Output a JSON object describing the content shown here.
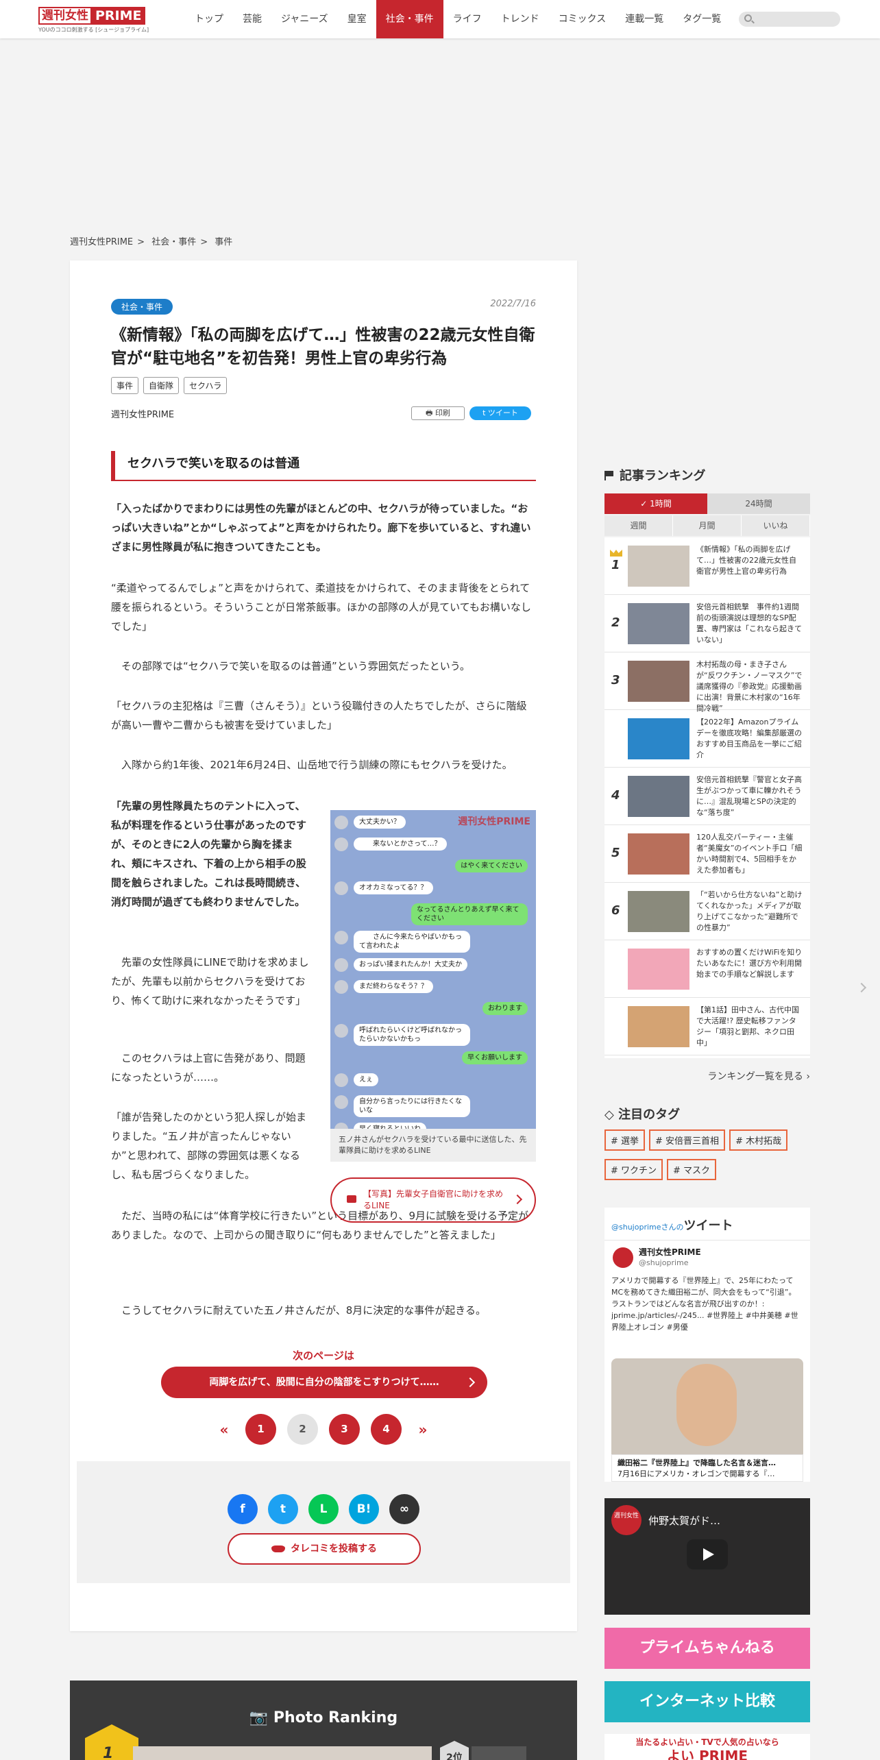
{
  "header": {
    "logo_main": "週刊女性",
    "logo_brand": "PRIME",
    "logo_sub": "YOUのココロ刺激する [シュージョプライム]",
    "nav": [
      "トップ",
      "芸能",
      "ジャニーズ",
      "皇室",
      "社会・事件",
      "ライフ",
      "トレンド",
      "コミックス",
      "連載一覧",
      "タグ一覧"
    ]
  },
  "breadcrumb": [
    "週刊女性PRIME",
    "社会・事件",
    "事件"
  ],
  "article": {
    "category": "社会・事件",
    "date": "2022/7/16",
    "title": "《新情報》「私の両脚を広げて…」性被害の22歳元女性自衛官が“駐屯地名”を初告発！男性上官の卑劣行為",
    "tags": [
      "事件",
      "自衛隊",
      "セクハラ"
    ],
    "author": "週刊女性PRIME",
    "print_label": "印刷",
    "tweet_label": "ツイート",
    "heading": "セクハラで笑いを取るのは普通",
    "p1": "「入ったばかりでまわりには男性の先輩がほとんどの中、セクハラが待っていました。“おっぱい大きいね”とか“しゃぶってよ”と声をかけられたり。廊下を歩いていると、すれ違いざまに男性隊員が私に抱きついてきたことも。",
    "p2": "“柔道やってるんでしょ”と声をかけられて、柔道技をかけられて、そのまま背後をとられて腰を振られるという。そういうことが日常茶飯事。ほかの部隊の人が見ていてもお構いなしでした」",
    "p3": "　その部隊では“セクハラで笑いを取るのは普通”という雰囲気だったという。",
    "p4": "「セクハラの主犯格は『三曹（さんそう）』という役職付きの人たちでしたが、さらに階級が高い一曹や二曹からも被害を受けていました」",
    "p5": "　入隊から約1年後、2021年6月24日、山岳地で行う訓練の際にもセクハラを受けた。",
    "p6": "「先輩の男性隊員たちのテントに入って、私が料理を作るという仕事があったのですが、そのときに2人の先輩から胸を揉まれ、頬にキスされ、下着の上から相手の股間を触らされました。これは長時間続き、消灯時間が過ぎても終わりませんでした。",
    "p7": "　先輩の女性隊員にLINEで助けを求めましたが、先輩も以前からセクハラを受けており、怖くて助けに来れなかったそうです」",
    "p8": "　このセクハラは上官に告発があり、問題になったというが……。",
    "p9": "「誰が告発したのかという犯人探しが始まりました。“五ノ井が言ったんじゃないか”と思われて、部隊の雰囲気は悪くなるし、私も居づらくなりました。",
    "p10": "　ただ、当時の私には“体育学校に行きたい”という目標があり、9月に試験を受ける予定がありました。なので、上司からの聞き取りに“何もありませんでした”と答えました」",
    "p11": "　こうしてセクハラに耐えていた五ノ井さんだが、8月に決定的な事件が起きる。",
    "figure_caption": "五ノ井さんがセクハラを受けている最中に送信した、先輩隊員に助けを求めるLINE",
    "figure_watermark": "週刊女性PRIME",
    "photo_link": "【写真】先輩女子自衛官に助けを求めるLINE",
    "next_label": "次のページは",
    "next_button": "両脚を広げて、股間に自分の陰部をこすりつけて……",
    "pager": [
      "1",
      "2",
      "3",
      "4"
    ],
    "pager_prev": "«",
    "pager_next": "»",
    "share": [
      {
        "icon": "facebook-icon",
        "glyph": "f",
        "color": "#1877f2"
      },
      {
        "icon": "twitter-icon",
        "glyph": "t",
        "color": "#1da1f2"
      },
      {
        "icon": "line-icon",
        "glyph": "L",
        "color": "#06c755"
      },
      {
        "icon": "hatena-icon",
        "glyph": "B!",
        "color": "#00a4de"
      },
      {
        "icon": "link-icon",
        "glyph": "∞",
        "color": "#333333"
      }
    ],
    "tarekomi": "タレコミを投稿する"
  },
  "chat": [
    {
      "side": "l",
      "text": "大丈夫かい？"
    },
    {
      "side": "l",
      "text": "　　来ないとかさって…？"
    },
    {
      "side": "r",
      "text": "はやく来てください"
    },
    {
      "side": "l",
      "text": "オオカミなってる？？"
    },
    {
      "side": "r",
      "text": "なってるさんとりあえず早く来てください"
    },
    {
      "side": "l",
      "text": "　　さんに今来たらやばいかもって言われたよ"
    },
    {
      "side": "l",
      "text": "おっぱい揉まれたんか！大丈夫か"
    },
    {
      "side": "l",
      "text": "まだ終わらなそう？？"
    },
    {
      "side": "r",
      "text": "おわります"
    },
    {
      "side": "l",
      "text": "呼ばれたらいくけど呼ばれなかったらいかないかもっ"
    },
    {
      "side": "r",
      "text": "早くお願いします"
    },
    {
      "side": "l",
      "text": "えぇ"
    },
    {
      "side": "l",
      "text": "自分から言ったりには行きたくないな"
    },
    {
      "side": "l",
      "text": "早く寝れるといいね"
    }
  ],
  "photo_ranking": {
    "title": "Photo Ranking",
    "rank1": "1",
    "rank2": "2位"
  },
  "sidebar": {
    "ranking_title": "記事ランキング",
    "tabs": [
      "1時間",
      "24時間"
    ],
    "subtabs": [
      "週間",
      "月間",
      "いいね"
    ],
    "items": [
      {
        "rank": "1",
        "text": "《新情報》「私の両脚を広げて…」性被害の22歳元女性自衛官が男性上官の卑劣行為",
        "thumb": "#cfc7bd"
      },
      {
        "rank": "2",
        "text": "安倍元首相銃撃　事件約1週間前の街頭演説は理想的なSP配置、専門家は「これなら起きていない」",
        "thumb": "#7f8796"
      },
      {
        "rank": "3",
        "text": "木村拓哉の母・まき子さんが“反ワクチン・ノーマスク”で議席獲得の『参政党』応援動画に出演！背景に木村家の“16年間冷戦”",
        "thumb": "#8c6f64"
      },
      {
        "rank": "",
        "text": "【2022年】Amazonプライムデーを徹底攻略！編集部厳選のおすすめ目玉商品を一挙にご紹介",
        "thumb": "#2a86c9"
      },
      {
        "rank": "4",
        "text": "安倍元首相銃撃『警官と女子高生がぶつかって車に轢かれそうに…』混乱現場とSPの決定的な“落ち度”",
        "thumb": "#6c7684"
      },
      {
        "rank": "5",
        "text": "120人乱交パーティー・主催者“美魔女”のイベント手口「細かい時間割で4、5回相手をかえた参加者も」",
        "thumb": "#b86f5b"
      },
      {
        "rank": "6",
        "text": "「“若いから仕方ないね”と助けてくれなかった」メディアが取り上げてこなかった“避難所での性暴力”",
        "thumb": "#8a8a7c"
      },
      {
        "rank": "",
        "text": "おすすめの置くだけWiFiを知りたいあなたに！選び方や利用開始までの手順など解説します",
        "thumb": "#f2a7b8"
      },
      {
        "rank": "",
        "text": "【第1話】田中さん、古代中国で大活躍!? 歴史転移ファンタジー「項羽と劉邦、ネクロ田中」",
        "thumb": "#d4a373"
      }
    ],
    "more_link": "ランキング一覧を見る",
    "tags_title": "注目のタグ",
    "tags": [
      "# 選挙",
      "# 安倍晋三首相",
      "# 木村拓哉",
      "# ワクチン",
      "# マスク"
    ],
    "tweet_by": "@shujoprimeさんの",
    "tweet_label": "ツイート",
    "tweet_name": "週刊女性PRIME",
    "tweet_handle": "@shujoprime",
    "tweet_text": "アメリカで開幕する『世界陸上』で、25年にわたってMCを務めてきた織田裕二が、同大会をもって“引退”。ラストランではどんな名言が飛び出すのか！: jprime.jp/articles/-/245... #世界陸上 #中井美穂 #世界陸上オレゴン #男優",
    "tweet_card_title": "織田裕二『世界陸上』で降臨した名言＆迷言…",
    "tweet_card_desc": "7月16日にアメリカ・オレゴンで開幕する『…",
    "yt_title": "仲野太賀がド…",
    "yt_logo": "週刊女性",
    "banner1": "プライムちゃんねる",
    "banner2": "インターネット比較",
    "banner3_sub": "当たるよい占い・TVで人気の占いなら",
    "banner3": "よい PRIME"
  }
}
